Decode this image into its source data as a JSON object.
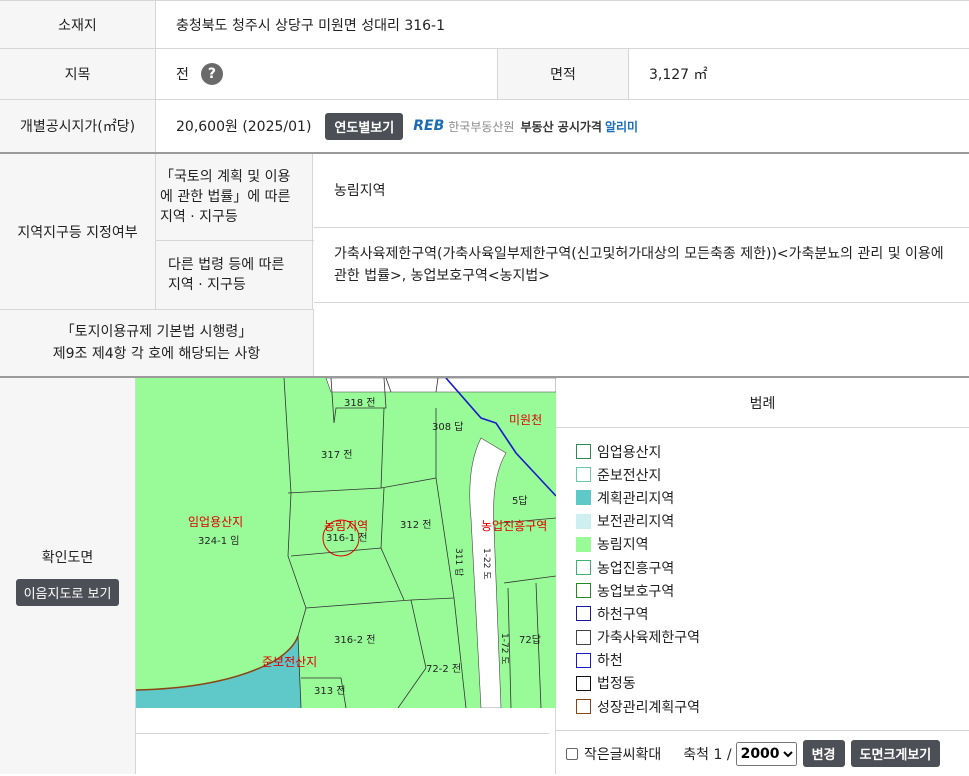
{
  "location": {
    "label": "소재지",
    "value": "충청북도 청주시 상당구 미원면 성대리 316-1"
  },
  "land_category": {
    "label": "지목",
    "value": "전",
    "help_icon": "question-circle-icon"
  },
  "area": {
    "label": "면적",
    "value": "3,127 ㎡"
  },
  "price": {
    "label": "개별공시지가(㎡당)",
    "value": "20,600원 (2025/01)",
    "yearly_button": "연도별보기",
    "reb_logo": "REB",
    "reb_org": "한국부동산원",
    "reb_service_a": "부동산 공시가격",
    "reb_service_b": "알리미"
  },
  "zoning": {
    "label": "지역지구등 지정여부",
    "national_label": "「국토의 계획 및 이용\n에 관한 법률」에 따른\n지역 · 지구등",
    "national_value": "농림지역",
    "other_label": "다른 법령 등에 따른\n지역 · 지구등",
    "other_value": "가축사육제한구역(가축사육일부제한구역(신고및허가대상의 모든축종 제한))<가축분뇨의 관리 및 이용에 관한 법률>, 농업보호구역<농지법>"
  },
  "enforcement": {
    "label": "「토지이용규제 기본법 시행령」\n제9조 제4항 각 호에 해당되는 사항",
    "value": ""
  },
  "map": {
    "label": "확인도면",
    "view_button": "이음지도로 보기",
    "labels": {
      "forest": "임업용산지",
      "forest_lot": "324-1 임",
      "agri": "농림지역",
      "agri_lot": "316-1 전",
      "promo": "농업진흥구역",
      "semi": "준보전산지",
      "lake": "미원천",
      "p318": "318 전",
      "p308": "308 답",
      "p317": "317 전",
      "p312": "312 전",
      "p5": "5답",
      "p3162": "316-2 전",
      "p722": "72-2 전",
      "p313": "313 전",
      "p72": "72답",
      "p311": "311 답",
      "p1": "1-22 도",
      "p172": "1-72 도"
    }
  },
  "legend": {
    "title": "범례",
    "items": [
      {
        "label": "임업용산지",
        "fill": "#ffffff",
        "border": "#2e8b57"
      },
      {
        "label": "준보전산지",
        "fill": "#ffffff",
        "border": "#66cdaa"
      },
      {
        "label": "계획관리지역",
        "fill": "#5fc8c8",
        "border": "#5fc8c8"
      },
      {
        "label": "보전관리지역",
        "fill": "#cdeff0",
        "border": "#cdeff0"
      },
      {
        "label": "농림지역",
        "fill": "#98fb98",
        "border": "#98fb98"
      },
      {
        "label": "농업진흥구역",
        "fill": "#ffffff",
        "border": "#3cb371"
      },
      {
        "label": "농업보호구역",
        "fill": "#ffffff",
        "border": "#228b22"
      },
      {
        "label": "하천구역",
        "fill": "#ffffff",
        "border": "#1a1aa0"
      },
      {
        "label": "가축사육제한구역",
        "fill": "#ffffff",
        "border": "#444444"
      },
      {
        "label": "하천",
        "fill": "#ffffff",
        "border": "#1a1acc"
      },
      {
        "label": "법정동",
        "fill": "#ffffff",
        "border": "#111111"
      },
      {
        "label": "성장관리계획구역",
        "fill": "#ffffff",
        "border": "#8b4513"
      }
    ]
  },
  "map_controls": {
    "small_text_label": "작은글씨확대",
    "scale_label": "축척 1 /",
    "scale_value": "2000",
    "change_button": "변경",
    "enlarge_button": "도면크게보기"
  }
}
